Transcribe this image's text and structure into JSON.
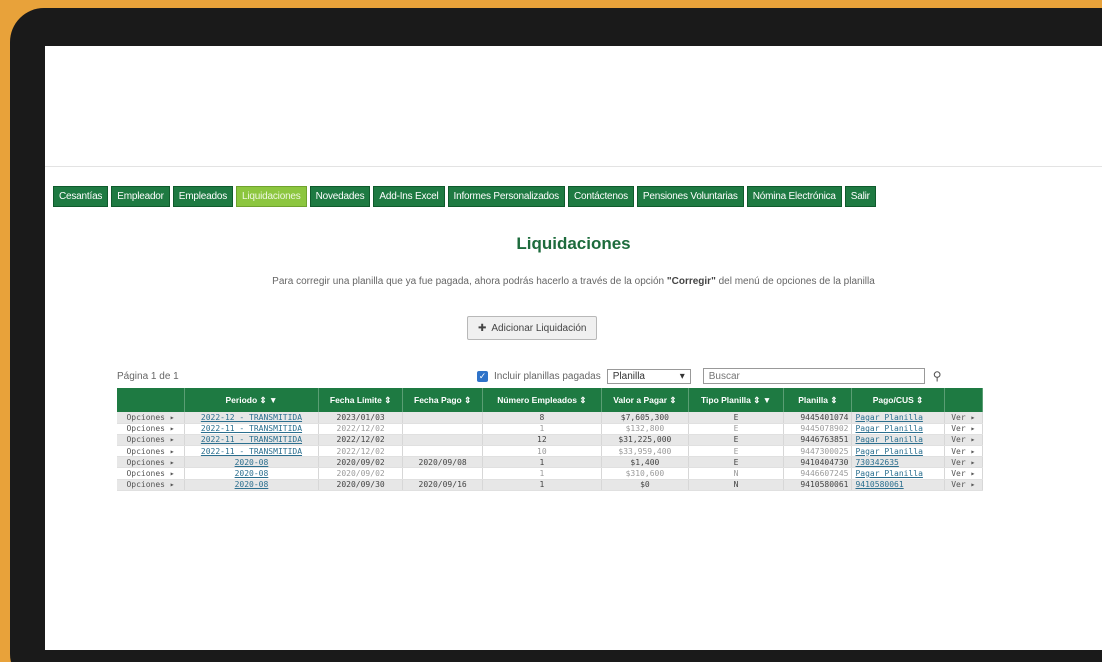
{
  "nav": [
    {
      "label": "Cesantías",
      "active": false
    },
    {
      "label": "Empleador",
      "active": false
    },
    {
      "label": "Empleados",
      "active": false
    },
    {
      "label": "Liquidaciones",
      "active": true
    },
    {
      "label": "Novedades",
      "active": false
    },
    {
      "label": "Add-Ins Excel",
      "active": false
    },
    {
      "label": "Informes Personalizados",
      "active": false
    },
    {
      "label": "Contáctenos",
      "active": false
    },
    {
      "label": "Pensiones Voluntarias",
      "active": false
    },
    {
      "label": "Nómina Electrónica",
      "active": false
    },
    {
      "label": "Salir",
      "active": false
    }
  ],
  "page": {
    "title": "Liquidaciones",
    "note_before": "Para corregir una planilla que ya fue pagada, ahora podrás hacerlo a través de la opción ",
    "note_bold": "\"Corregir\"",
    "note_after": " del menú de opciones de la planilla",
    "add_button": "Adicionar Liquidación",
    "pager": "Página 1 de 1"
  },
  "filters": {
    "include_paid_label": "Incluir planillas pagadas",
    "include_paid_checked": true,
    "select_value": "Planilla",
    "search_placeholder": "Buscar"
  },
  "table": {
    "headers": [
      "",
      "Periodo ⇕ ▼",
      "Fecha Límite ⇕",
      "Fecha Pago ⇕",
      "Número Empleados ⇕",
      "Valor a Pagar ⇕",
      "Tipo Planilla ⇕ ▼",
      "Planilla ⇕",
      "Pago/CUS ⇕",
      ""
    ],
    "rows": [
      {
        "opciones": "Opciones ▸",
        "periodo": "2022-12 - TRANSMITIDA",
        "limite": "2023/01/03",
        "pago": "",
        "empleados": "8",
        "valor": "$7,605,300",
        "tipo": "E",
        "planilla": "9445401074",
        "cus": "Pagar Planilla",
        "ver": "Ver ▸",
        "style": "dark"
      },
      {
        "opciones": "Opciones ▸",
        "periodo": "2022-11 - TRANSMITIDA",
        "limite": "2022/12/02",
        "pago": "",
        "empleados": "1",
        "valor": "$132,800",
        "tipo": "E",
        "planilla": "9445078902",
        "cus": "Pagar Planilla",
        "ver": "Ver ▸",
        "style": "light"
      },
      {
        "opciones": "Opciones ▸",
        "periodo": "2022-11 - TRANSMITIDA",
        "limite": "2022/12/02",
        "pago": "",
        "empleados": "12",
        "valor": "$31,225,000",
        "tipo": "E",
        "planilla": "9446763851",
        "cus": "Pagar Planilla",
        "ver": "Ver ▸",
        "style": "dark"
      },
      {
        "opciones": "Opciones ▸",
        "periodo": "2022-11 - TRANSMITIDA",
        "limite": "2022/12/02",
        "pago": "",
        "empleados": "10",
        "valor": "$33,959,400",
        "tipo": "E",
        "planilla": "9447300025",
        "cus": "Pagar Planilla",
        "ver": "Ver ▸",
        "style": "light"
      },
      {
        "opciones": "Opciones ▸",
        "periodo": "2020-08",
        "limite": "2020/09/02",
        "pago": "2020/09/08",
        "empleados": "1",
        "valor": "$1,400",
        "tipo": "E",
        "planilla": "9410404730",
        "cus": "730342635",
        "ver": "Ver ▸",
        "style": "dark"
      },
      {
        "opciones": "Opciones ▸",
        "periodo": "2020-08",
        "limite": "2020/09/02",
        "pago": "",
        "empleados": "1",
        "valor": "$310,600",
        "tipo": "N",
        "planilla": "9446607245",
        "cus": "Pagar Planilla",
        "ver": "Ver ▸",
        "style": "light"
      },
      {
        "opciones": "Opciones ▸",
        "periodo": "2020-08",
        "limite": "2020/09/30",
        "pago": "2020/09/16",
        "empleados": "1",
        "valor": "$0",
        "tipo": "N",
        "planilla": "9410580061",
        "cus": "9410580061",
        "ver": "Ver ▸",
        "style": "dark"
      }
    ]
  }
}
